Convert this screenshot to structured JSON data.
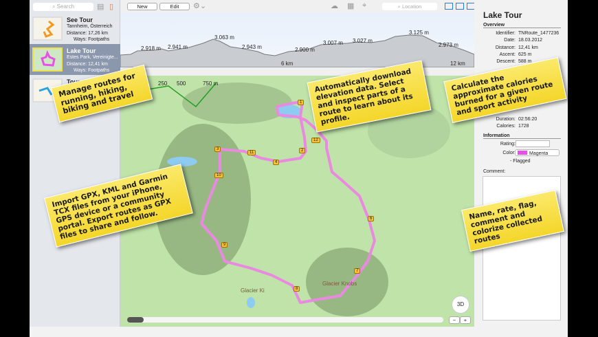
{
  "sidebar": {
    "search_placeholder": "Search",
    "routes": [
      {
        "name": "See Tour",
        "place": "Tannheim, Österreich",
        "distance": "Distance: 17,26 km",
        "ways": "Ways: Footpaths"
      },
      {
        "name": "Lake Tour",
        "place": "Estes Park, Vereinigte...",
        "distance": "Distance: 12,41 km",
        "ways": "Ways: Footpaths"
      },
      {
        "name": "Tour du La..."
      }
    ]
  },
  "toolbar": {
    "new": "New",
    "edit": "Edit",
    "location_placeholder": "Location"
  },
  "profile": {
    "labels": [
      "2.918 m",
      "2.941 m",
      "3.063 m",
      "2.943 m",
      "2.900 m",
      "3.007 m",
      "3.027 m",
      "3.125 m",
      "2.973 m"
    ],
    "axis": [
      "6 km",
      "12 km"
    ]
  },
  "map": {
    "scale": [
      "250",
      "500",
      "750 m"
    ],
    "waypoints": [
      "1",
      "2",
      "3",
      "4",
      "6",
      "7",
      "8",
      "9",
      "10",
      "11",
      "12"
    ],
    "compass": "3D",
    "zoom_out": "−",
    "zoom_in": "+",
    "place_labels": [
      "Glacier Ki",
      "Glacier Knobs"
    ]
  },
  "inspector": {
    "title": "Lake Tour",
    "overview": "Overview",
    "rows": [
      {
        "label": "Identifier:",
        "value": "TNRoute_1477236"
      },
      {
        "label": "Date:",
        "value": "18.03.2012"
      },
      {
        "label": "Distance:",
        "value": "12,41 km"
      },
      {
        "label": "Ascent:",
        "value": "625 m"
      },
      {
        "label": "Descent:",
        "value": "588 m"
      }
    ],
    "duration_label": "Duration:",
    "duration": "02:56:20",
    "calories_label": "Calories:",
    "calories": "1728",
    "information": "Information",
    "rating_label": "Rating:",
    "color_label": "Color:",
    "color_value": "Magenta",
    "color_hex": "#e84ee8",
    "flagged": "Flagged",
    "comment_label": "Comment:"
  },
  "callouts": {
    "manage": "Manage routes for running, hiking, biking and travel",
    "elevation": "Automatically download elevation data. Select and inspect parts of a route to learn about its profile.",
    "calories": "Calculate the approximate calories burned for a given route and sport activity",
    "import": "Import GPX, KML and Garmin TCX files from your iPhone, GPS device or a community portal. Export routes as GPX files to share and follow.",
    "rate": "Name, rate, flag, comment and colorize collected routes"
  }
}
